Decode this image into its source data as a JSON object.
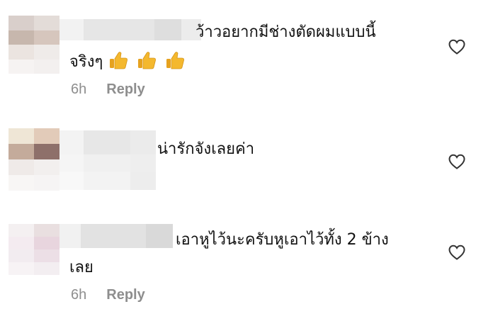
{
  "comments": [
    {
      "line1": "ว้าวอยากมีช่างตัดผมแบบนี้",
      "line2": "จริงๆ",
      "emoji": "thumbs-up-icon",
      "time": "6h",
      "reply": "Reply"
    },
    {
      "line1": "น่ารักจังเลยค่า"
    },
    {
      "line1": "เอาหูไว้นะครับหูเอาไว้ทั้ง 2 ข้าง",
      "line2": "เลย",
      "time": "6h",
      "reply": "Reply"
    }
  ],
  "icons": {
    "like": "heart-outline-icon",
    "thumbs": "thumbs-up-icon"
  },
  "colors": {
    "meta": "#8e8e8e",
    "text": "#111111",
    "emoji": "#f4b82e"
  }
}
